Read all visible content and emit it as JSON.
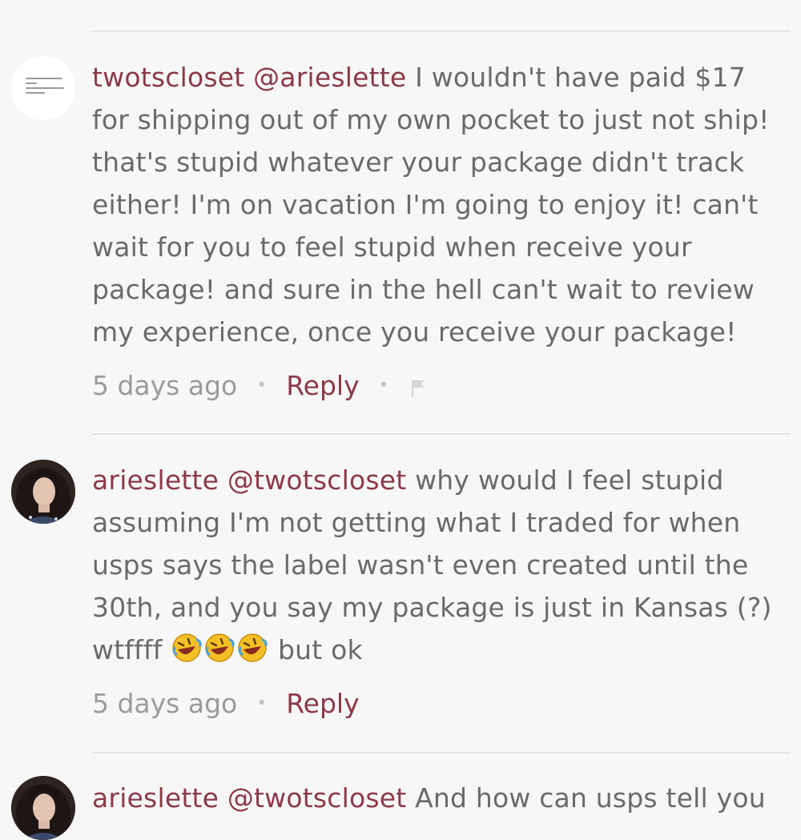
{
  "comments": [
    {
      "username": "twotscloset",
      "mention": "@arieslette",
      "text": " I wouldn't have paid $17 for shipping out of my own pocket to just not ship! that's stupid whatever your package didn't track either! I'm on vacation I'm going to enjoy it! can't wait for you to feel stupid when receive your package! and sure in the hell can't wait to review my experience, once you receive your package!",
      "time": "5 days ago",
      "reply_label": "Reply"
    },
    {
      "username": "arieslette",
      "mention": "@twotscloset",
      "text": " why would I feel stupid assuming I'm not getting what I traded for when usps says the label wasn't even created until the 30th, and you say my package is just in Kansas (?) wtffff ",
      "text_after_emoji": " but ok",
      "time": "5 days ago",
      "reply_label": "Reply"
    },
    {
      "username": "arieslette",
      "mention": "@twotscloset",
      "text": " And how can usps tell you"
    }
  ],
  "colors": {
    "accent": "#8b3a47",
    "body_text": "#6a6a6a",
    "meta_text": "#9b9b9b",
    "background": "#f7f7f7"
  },
  "icons": {
    "flag": "flag-icon",
    "emoji": "rolling-on-floor-laughing-emoji"
  }
}
